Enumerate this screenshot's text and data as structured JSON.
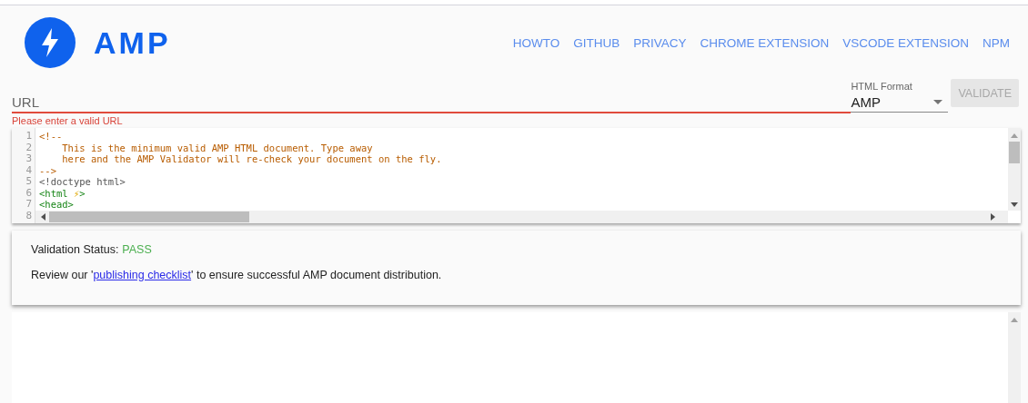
{
  "header": {
    "logo_text": "AMP",
    "nav": [
      {
        "label": "HOWTO"
      },
      {
        "label": "GITHUB"
      },
      {
        "label": "PRIVACY"
      },
      {
        "label": "CHROME EXTENSION"
      },
      {
        "label": "VSCODE EXTENSION"
      },
      {
        "label": "NPM"
      }
    ]
  },
  "url_field": {
    "placeholder": "URL",
    "invalid": true,
    "error": "Please enter a valid URL"
  },
  "format_select": {
    "label": "HTML Format",
    "value": "AMP"
  },
  "validate_button": {
    "label": "VALIDATE",
    "disabled": true
  },
  "editor": {
    "lines": [
      {
        "number": "1",
        "segments": [
          {
            "kind": "comment",
            "text": "<!--"
          }
        ]
      },
      {
        "number": "2",
        "segments": [
          {
            "kind": "comment",
            "text": "    This is the minimum valid AMP HTML document. Type away"
          }
        ]
      },
      {
        "number": "3",
        "segments": [
          {
            "kind": "comment",
            "text": "    here and the AMP Validator will re-check your document on the fly."
          }
        ]
      },
      {
        "number": "4",
        "segments": [
          {
            "kind": "comment",
            "text": "-->"
          }
        ]
      },
      {
        "number": "5",
        "segments": [
          {
            "kind": "doctype",
            "text": "<!doctype html>"
          }
        ]
      },
      {
        "number": "6",
        "segments": [
          {
            "kind": "tag",
            "text": "<html "
          },
          {
            "kind": "emoji",
            "text": "⚡"
          },
          {
            "kind": "tag",
            "text": ">"
          }
        ]
      },
      {
        "number": "7",
        "segments": [
          {
            "kind": "tag",
            "text": "<head>"
          }
        ]
      },
      {
        "number": "8"
      }
    ]
  },
  "status_card": {
    "label": "Validation Status:",
    "status": "PASS",
    "passed": true,
    "note_prefix": "Review our '",
    "note_link": "publishing checklist",
    "note_suffix": "' to ensure successful AMP document distribution."
  }
}
